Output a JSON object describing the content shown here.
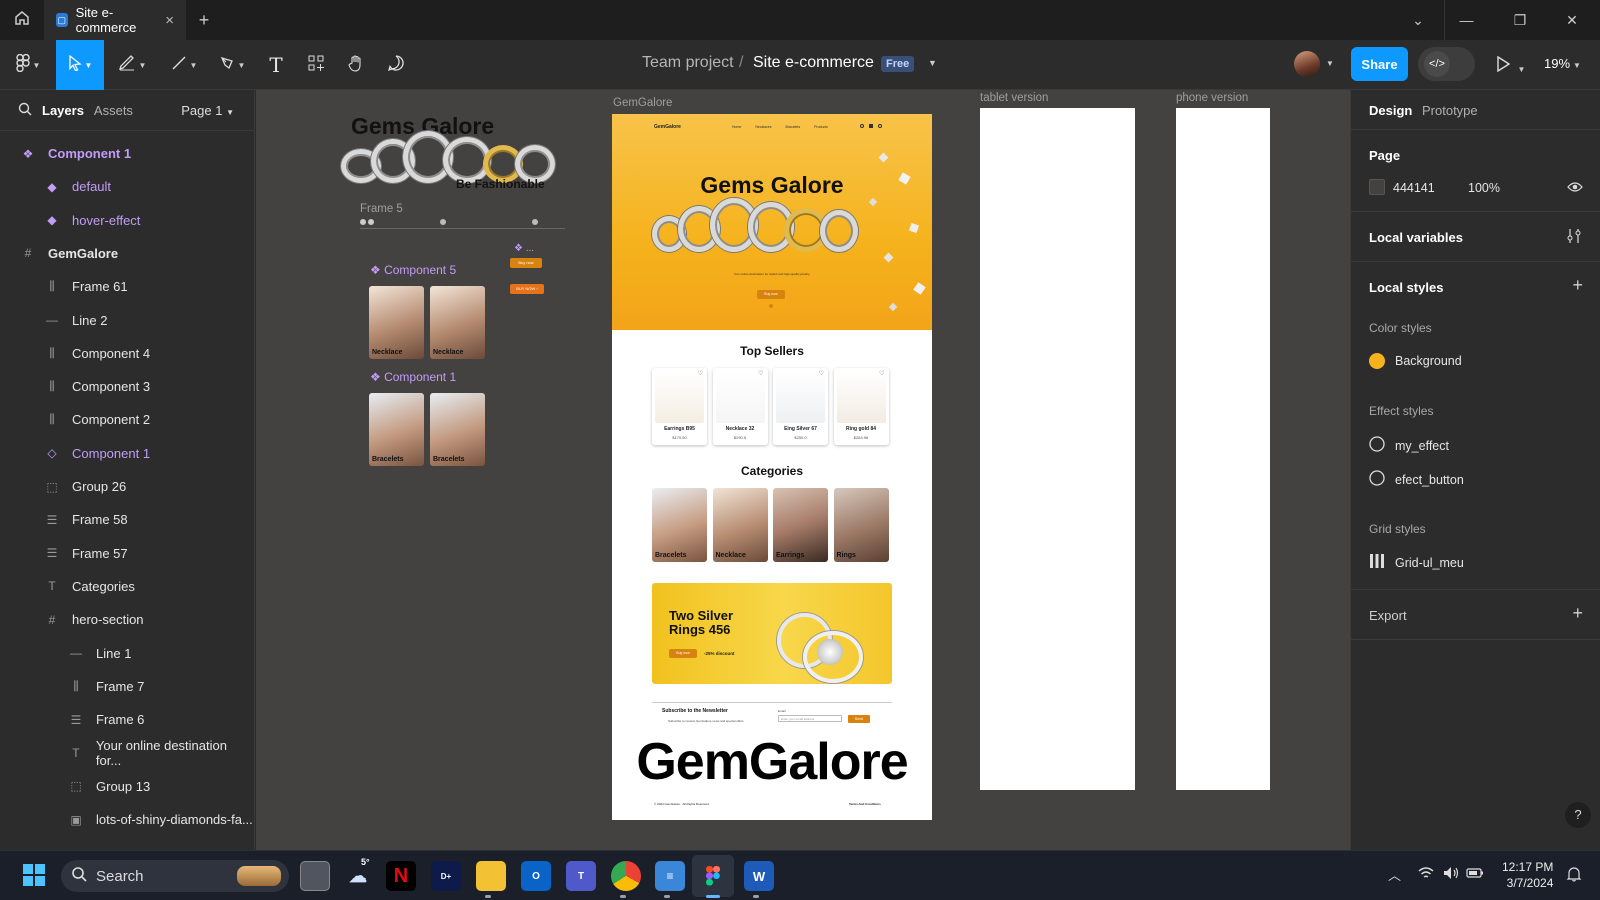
{
  "window": {
    "tab_title": "Site e-commerce",
    "new_tab": "+",
    "tab_close": "×"
  },
  "toolbar": {
    "breadcrumb_team": "Team project",
    "breadcrumb_sep": "/",
    "file_name": "Site e-commerce",
    "plan_badge": "Free",
    "share_label": "Share",
    "zoom": "19%"
  },
  "left_panel": {
    "tabs": [
      "Layers",
      "Assets"
    ],
    "page_selector": "Page 1",
    "layers": [
      {
        "name": "Component 1",
        "type": "component-set",
        "purple": true
      },
      {
        "name": "default",
        "type": "variant",
        "purple": true
      },
      {
        "name": "hover-effect",
        "type": "variant",
        "purple": true
      },
      {
        "name": "GemGalore",
        "type": "frame",
        "purple": false
      },
      {
        "name": "Frame 61",
        "type": "autolayout-v",
        "purple": false
      },
      {
        "name": "Line 2",
        "type": "line",
        "purple": false
      },
      {
        "name": "Component 4",
        "type": "autolayout-v",
        "purple": false
      },
      {
        "name": "Component 3",
        "type": "autolayout-v",
        "purple": false
      },
      {
        "name": "Component 2",
        "type": "autolayout-v",
        "purple": false
      },
      {
        "name": "Component 1",
        "type": "instance",
        "purple": true
      },
      {
        "name": "Group 26",
        "type": "group",
        "purple": false
      },
      {
        "name": "Frame 58",
        "type": "autolayout-h",
        "purple": false
      },
      {
        "name": "Frame 57",
        "type": "autolayout-h",
        "purple": false
      },
      {
        "name": "Categories",
        "type": "text",
        "purple": false
      },
      {
        "name": "hero-section",
        "type": "frame",
        "purple": false
      },
      {
        "name": "Line 1",
        "type": "line",
        "purple": false
      },
      {
        "name": "Frame 7",
        "type": "autolayout-v",
        "purple": false
      },
      {
        "name": "Frame 6",
        "type": "autolayout-h",
        "purple": false
      },
      {
        "name": "Your online destination for...",
        "type": "text",
        "purple": false
      },
      {
        "name": "Group 13",
        "type": "group",
        "purple": false
      },
      {
        "name": "lots-of-shiny-diamonds-fa...",
        "type": "image",
        "purple": false
      }
    ]
  },
  "canvas": {
    "frame_labels": {
      "main": "GemGalore",
      "tablet": "tablet version",
      "phone": "phone version",
      "frame5": "Frame 5",
      "component5": "Component 5",
      "component1": "Component 1",
      "component_dots": "..."
    },
    "top_hero_title": "Gems Galore",
    "top_hero_subtitle": "Be Fashionable",
    "component5_labels": [
      "Necklace",
      "Necklace"
    ],
    "component1_labels": [
      "Bracelets",
      "Bracelets"
    ],
    "site": {
      "logo": "GemGalore",
      "nav": [
        "Home",
        "Necklaces",
        "Bracelets",
        "Products"
      ],
      "hero_title": "Gems Galore",
      "hero_tagline": "Your online destination for stylish and high-quality jewelry.",
      "hero_button": "Buy now",
      "top_sellers_title": "Top Sellers",
      "products": [
        {
          "name": "Earrings B95",
          "price": "$170.50"
        },
        {
          "name": "Necklace 32",
          "price": "$290.5"
        },
        {
          "name": "Eing Silver 67",
          "price": "$250.0"
        },
        {
          "name": "Ring gold 84",
          "price": "$284.96"
        }
      ],
      "categories_title": "Categories",
      "categories": [
        "Bracelets",
        "Necklace",
        "Earrings",
        "Rings"
      ],
      "promo_title": "Two Silver Rings 456",
      "promo_button": "Buy now",
      "promo_discount": "-25% discount",
      "newsletter_title": "Subscribe to the Newsletter",
      "newsletter_text": "Subscribe to receive GemGalore news and special offers",
      "newsletter_email_label": "Email",
      "newsletter_placeholder": "Enter your email address",
      "newsletter_button": "Send",
      "footer_logo": "GemGalore",
      "copyright": "© 2024 GemGalore . All Rights Reserved.",
      "terms": "Terms And Conditions",
      "button_small_1": "Buy now",
      "button_small_2": "BUY NOW ›"
    }
  },
  "right_panel": {
    "tabs": [
      "Design",
      "Prototype"
    ],
    "page_title": "Page",
    "page_color": "444141",
    "page_opacity": "100%",
    "local_variables": "Local variables",
    "local_styles": "Local styles",
    "color_styles_title": "Color styles",
    "color_styles": [
      {
        "name": "Background",
        "color": "#f5b21c"
      }
    ],
    "effect_styles_title": "Effect styles",
    "effect_styles": [
      "my_effect",
      "efect_button"
    ],
    "grid_styles_title": "Grid styles",
    "grid_styles": [
      "Grid-ul_meu"
    ],
    "export": "Export",
    "help": "?"
  },
  "taskbar": {
    "search_placeholder": "Search",
    "weather_temp": "5°",
    "time": "12:17 PM",
    "date": "3/7/2024"
  },
  "colors": {
    "accent": "#0d99ff",
    "canvas_bg": "#444141",
    "component_purple": "#c39cf7",
    "hero_yellow": "#f5b21c",
    "button_orange": "#d9830f"
  }
}
